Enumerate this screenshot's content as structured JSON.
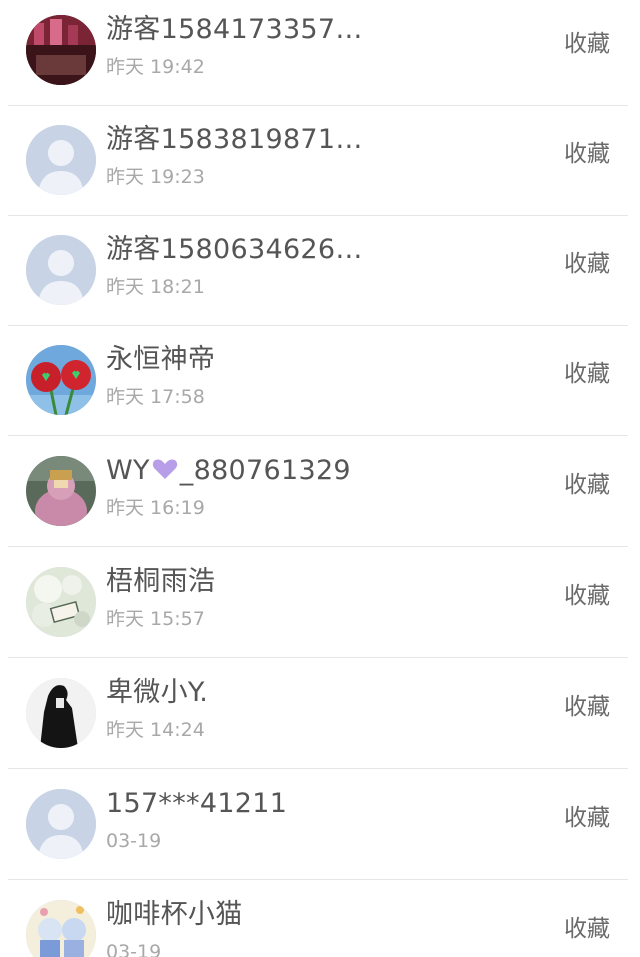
{
  "favorites": {
    "rows": [
      {
        "name": "游客1584173357…",
        "time": "昨天 19:42",
        "action": "收藏",
        "avatar": "photo-red-avatar"
      },
      {
        "name": "游客1583819871…",
        "time": "昨天 19:23",
        "action": "收藏",
        "avatar": "default-avatar"
      },
      {
        "name": "游客1580634626…",
        "time": "昨天 18:21",
        "action": "收藏",
        "avatar": "default-avatar"
      },
      {
        "name": "永恒神帝",
        "time": "昨天 17:58",
        "action": "收藏",
        "avatar": "red-flowers-avatar"
      },
      {
        "name_prefix": "WY",
        "name_suffix": "_880761329",
        "time": "昨天 16:19",
        "action": "收藏",
        "avatar": "character-avatar"
      },
      {
        "name": "梧桐雨浩",
        "time": "昨天 15:57",
        "action": "收藏",
        "avatar": "white-flower-avatar"
      },
      {
        "name": "卑微小Y.",
        "time": "昨天 14:24",
        "action": "收藏",
        "avatar": "dark-figure-avatar"
      },
      {
        "name": "157***41211",
        "time": "03-19",
        "action": "收藏",
        "avatar": "default-avatar"
      },
      {
        "name": "咖啡杯小猫",
        "time": "03-19",
        "action": "收藏",
        "avatar": "anime-avatar"
      }
    ]
  },
  "colors": {
    "name": "#555555",
    "time": "#a8a8a8",
    "action": "#6a6a6a",
    "divider": "#e6e6e6",
    "default_avatar_bg": "#c8d4e6",
    "heart": "#b89ee8"
  }
}
